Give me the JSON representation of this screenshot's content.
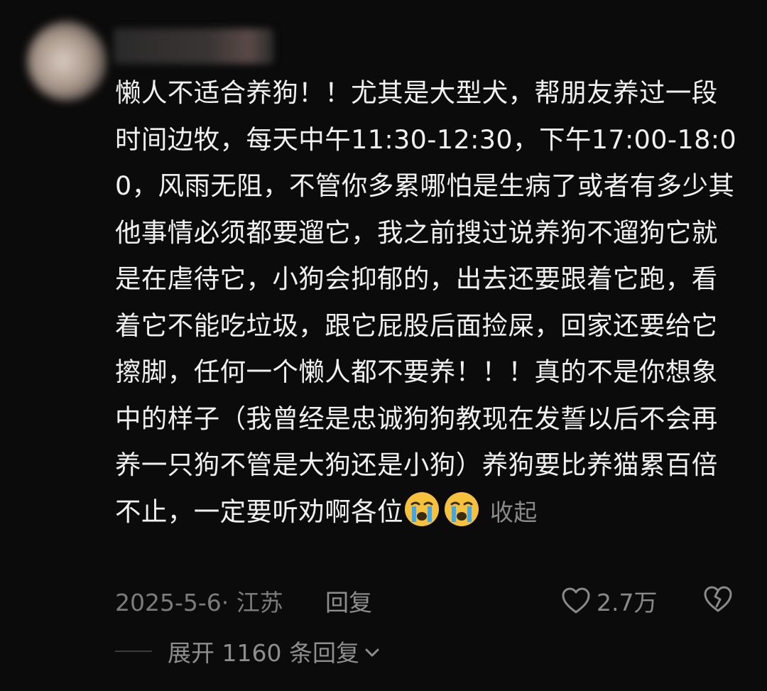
{
  "comment": {
    "text": "懒人不适合养狗！！尤其是大型犬，帮朋友养过一段时间边牧，每天中午11:30-12:30，下午17:00-18:00，风雨无阻，不管你多累哪怕是生病了或者有多少其他事情必须都要遛它，我之前搜过说养狗不遛狗它就是在虐待它，小狗会抑郁的，出去还要跟着它跑，看着它不能吃垃圾，跟它屁股后面捡屎，回家还要给它擦脚，任何一个懒人都不要养！！！真的不是你想象中的样子（我曾经是忠诚狗狗教现在发誓以后不会再养一只狗不管是大狗还是小狗）养狗要比养猫累百倍不止，一定要听劝啊各位",
    "emojis": [
      "crying-face-icon",
      "crying-face-icon"
    ],
    "collapse_label": "收起",
    "date_location": "2025-5-6· 江苏",
    "reply_label": "回复",
    "like_count": "2.7万",
    "expand_label": "展开 1160 条回复"
  },
  "colors": {
    "background": "#0b0b0b",
    "text": "#f0f0f0",
    "muted": "#7c7c7c",
    "emoji_face": "#f7c23b",
    "emoji_tear": "#3fa6f0"
  }
}
